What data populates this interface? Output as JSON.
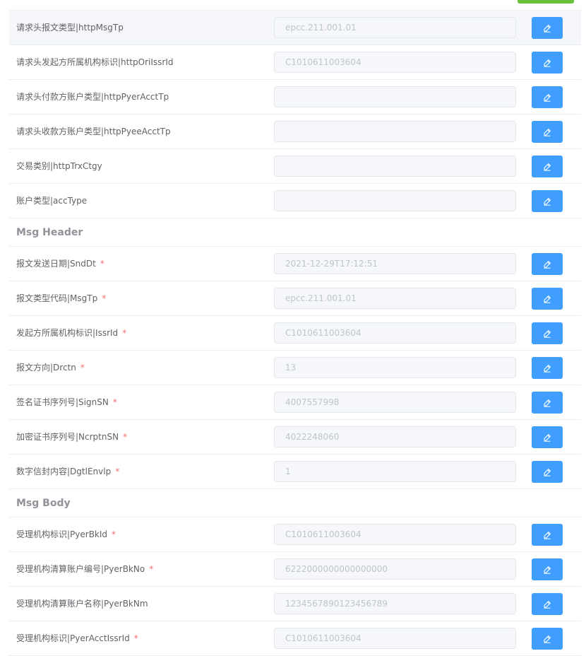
{
  "rows_http": [
    {
      "label": "请求头报文类型|httpMsgTp",
      "value": "epcc.211.001.01",
      "required": false
    },
    {
      "label": "请求头发起方所属机构标识|httpOriIssrId",
      "value": "C1010611003604",
      "required": false
    },
    {
      "label": "请求头付款方账户类型|httpPyerAcctTp",
      "value": "",
      "required": false
    },
    {
      "label": "请求头收款方账户类型|httpPyeeAcctTp",
      "value": "",
      "required": false
    },
    {
      "label": "交易类别|httpTrxCtgy",
      "value": "",
      "required": false
    },
    {
      "label": "账户类型|accType",
      "value": "",
      "required": false
    }
  ],
  "section_header": {
    "title": "Msg Header"
  },
  "rows_header": [
    {
      "label": "报文发送日期|SndDt",
      "value": "2021-12-29T17:12:51",
      "required": true
    },
    {
      "label": "报文类型代码|MsgTp",
      "value": "epcc.211.001.01",
      "required": true
    },
    {
      "label": "发起方所属机构标识|IssrId",
      "value": "C1010611003604",
      "required": true
    },
    {
      "label": "报文方向|Drctn",
      "value": "13",
      "required": true
    },
    {
      "label": "签名证书序列号|SignSN",
      "value": "4007557998",
      "required": true
    },
    {
      "label": "加密证书序列号|NcrptnSN",
      "value": "4022248060",
      "required": true
    },
    {
      "label": "数字信封内容|DgtlEnvlp",
      "value": "1",
      "required": true
    }
  ],
  "section_body": {
    "title": "Msg Body"
  },
  "rows_body": [
    {
      "label": "受理机构标识|PyerBkId",
      "value": "C1010611003604",
      "required": true
    },
    {
      "label": "受理机构清算账户编号|PyerBkNo",
      "value": "6222000000000000000",
      "required": true
    },
    {
      "label": "受理机构清算账户名称|PyerBkNm",
      "value": "1234567890123456789",
      "required": false
    },
    {
      "label": "受理机构标识|PyerAcctIssrId",
      "value": "C1010611003604",
      "required": true
    }
  ],
  "required_mark": "*",
  "colors": {
    "primary": "#409eff",
    "success": "#67c23a",
    "danger": "#f56c6c",
    "border": "#ebeef5",
    "label": "#606266",
    "input_text": "#c0c4cc",
    "input_bg": "#f5f7fa"
  },
  "edit_icon": "edit-icon"
}
